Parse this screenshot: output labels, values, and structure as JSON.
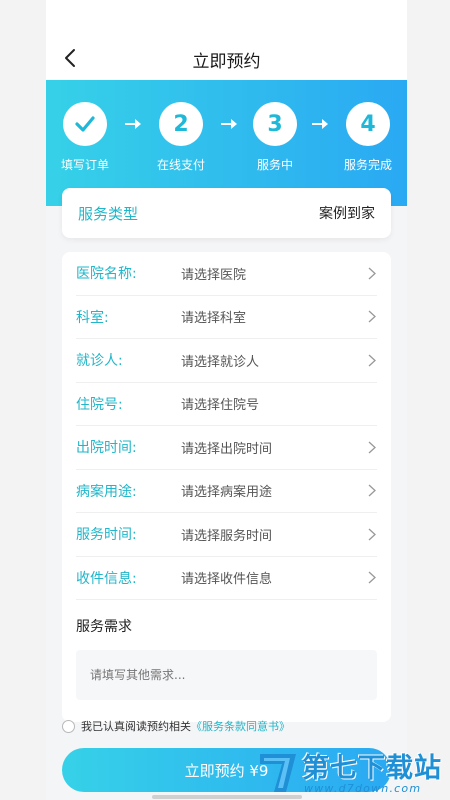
{
  "navbar": {
    "title": "立即预约"
  },
  "steps": [
    {
      "num": "",
      "label": "填写订单",
      "done": true
    },
    {
      "num": "2",
      "label": "在线支付",
      "done": false
    },
    {
      "num": "3",
      "label": "服务中",
      "done": false
    },
    {
      "num": "4",
      "label": "服务完成",
      "done": false
    }
  ],
  "service_type": {
    "label": "服务类型",
    "value": "案例到家"
  },
  "form": {
    "rows": [
      {
        "label": "医院名称:",
        "placeholder": "请选择医院",
        "has_chevron": true
      },
      {
        "label": "科室:",
        "placeholder": "请选择科室",
        "has_chevron": true
      },
      {
        "label": "就诊人:",
        "placeholder": "请选择就诊人",
        "has_chevron": true
      },
      {
        "label": "住院号:",
        "placeholder": "请选择住院号",
        "has_chevron": false
      },
      {
        "label": "出院时间:",
        "placeholder": "请选择出院时间",
        "has_chevron": true
      },
      {
        "label": "病案用途:",
        "placeholder": "请选择病案用途",
        "has_chevron": true
      },
      {
        "label": "服务时间:",
        "placeholder": "请选择服务时间",
        "has_chevron": true
      },
      {
        "label": "收件信息:",
        "placeholder": "请选择收件信息",
        "has_chevron": true
      }
    ],
    "needs_title": "服务需求",
    "needs_placeholder": "请填写其他需求..."
  },
  "agreement": {
    "text": "我已认真阅读预约相关",
    "link": "《服务条款同意书》"
  },
  "submit": {
    "label": "立即预约 ¥9"
  },
  "watermark": {
    "name": "第七下载站",
    "url": "www.d7down.com"
  },
  "colors": {
    "accent": "#21b6c9",
    "gradient_start": "#36d1e8",
    "gradient_end": "#2aa9f3"
  }
}
